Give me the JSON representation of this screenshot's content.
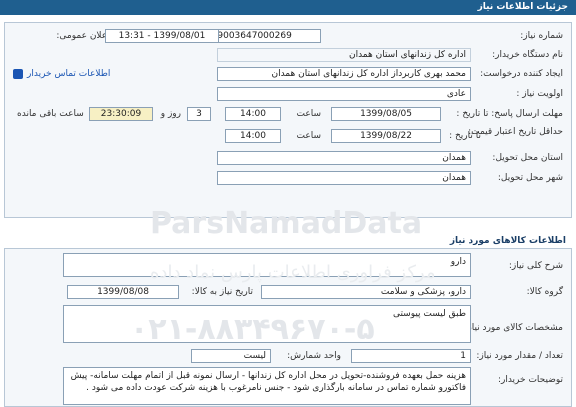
{
  "header": {
    "title": "جزئیات اطلاعات نیاز"
  },
  "fields": {
    "need_number_label": "شماره نیاز:",
    "need_number": "1299003647000269",
    "announce_label": "تاریخ و ساعت اعلان عمومی:",
    "announce_value": "1399/08/01 - 13:31",
    "buyer_label": "نام دستگاه خریدار:",
    "buyer": "اداره کل زندانهای استان همدان",
    "creator_label": "ایجاد کننده درخواست:",
    "creator": "محمد بهری کاربرداز اداره کل زندانهای استان همدان",
    "contact_link": "اطلاعات تماس خریدار",
    "priority_label": "اولویت نیاز :",
    "priority": "عادی",
    "reply_deadline_label": "مهلت ارسال پاسخ: تا تاریخ :",
    "reply_date": "1399/08/05",
    "time_label": "ساعت",
    "reply_time": "14:00",
    "days": "3",
    "days_label": "روز و",
    "remaining": "23:30:09",
    "remaining_label": "ساعت باقی مانده",
    "price_validity_label": "حداقل تاریخ اعتبار قیمت:",
    "price_until_label": "تا تاریخ :",
    "price_date": "1399/08/22",
    "price_time": "14:00",
    "province_label": "استان محل تحویل:",
    "province": "همدان",
    "city_label": "شهر محل تحویل:",
    "city": "همدان"
  },
  "goods": {
    "section_title": "اطلاعات کالاهای مورد نیاز",
    "general_desc_label": "شرح کلی نیاز:",
    "general_desc": "دارو",
    "group_label": "گروه کالا:",
    "group": "دارو، پزشکی و سلامت",
    "need_date_label": "تاریخ نیاز به کالا:",
    "need_date": "1399/08/08",
    "spec_label": "مشخصات کالای مورد نیاز:",
    "spec": "طبق لیست پیوستی",
    "qty_label": "تعداد / مقدار مورد نیاز:",
    "qty": "1",
    "unit_label": "واحد شمارش:",
    "unit": "لیست",
    "buyer_notes_label": "توضیحات خریدار:",
    "buyer_notes": "هزینه حمل بعهده فروشنده-تحویل در محل اداره کل زندانها - ارسال نمونه قبل از اتمام مهلت سامانه- پیش فاکتورو شماره تماس در سامانه بارگذاری شود - جنس نامرغوب با هزینه شرکت عودت داده می شود ."
  },
  "watermark": {
    "site": "ParsNamadData",
    "phone": "۰۲۱-۸۸۳۴۹۶۷۰-۵",
    "tagline": "مرکز فراوری اطلاعات پارس نماد داده"
  }
}
